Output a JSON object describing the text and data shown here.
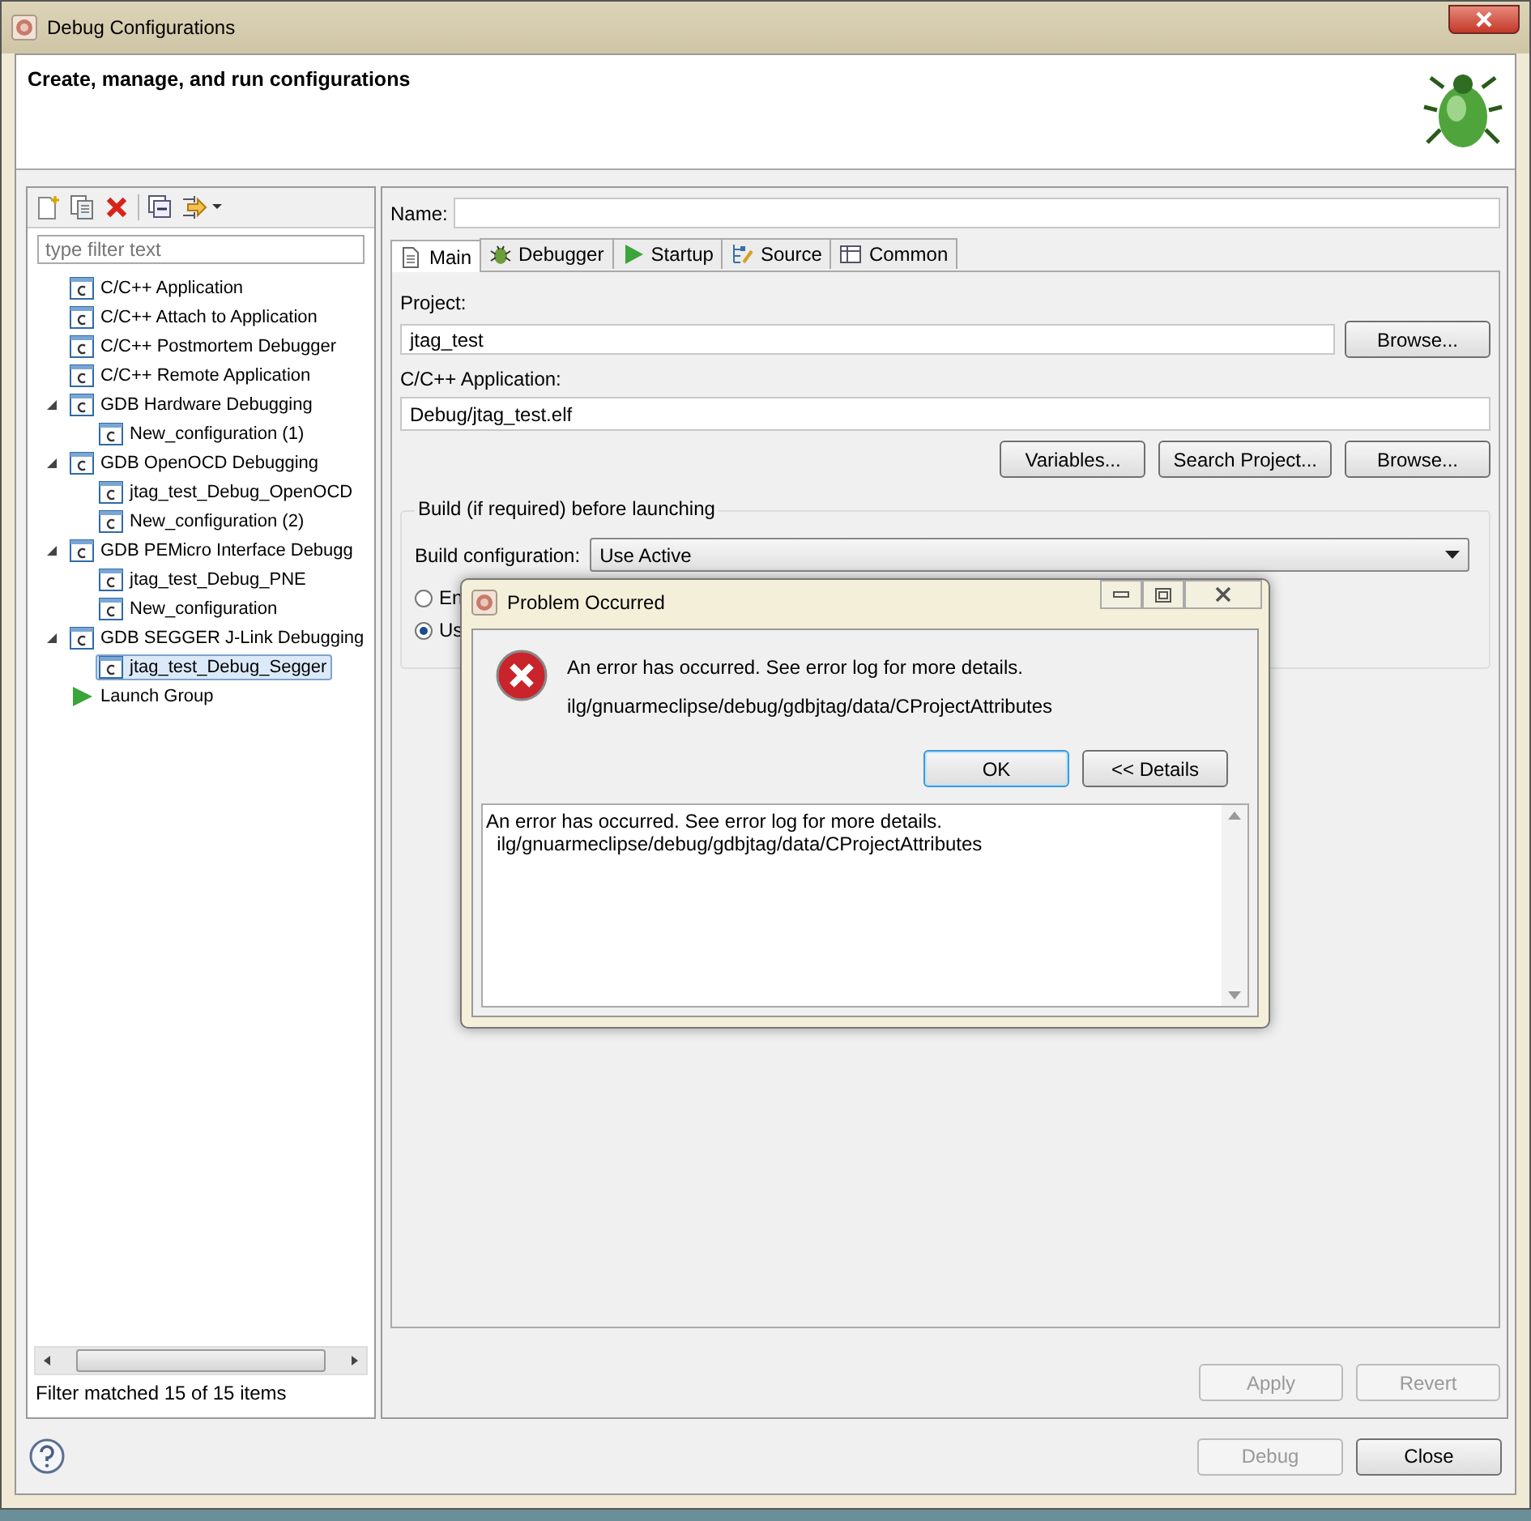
{
  "window": {
    "title": "Debug Configurations"
  },
  "header": {
    "title": "Create, manage, and run configurations"
  },
  "filter": {
    "placeholder": "type filter text"
  },
  "tree": [
    {
      "label": "C/C++ Application",
      "kind": "config",
      "selected": false
    },
    {
      "label": "C/C++ Attach to Application",
      "kind": "config",
      "selected": false
    },
    {
      "label": "C/C++ Postmortem Debugger",
      "kind": "config",
      "selected": false
    },
    {
      "label": "C/C++ Remote Application",
      "kind": "config",
      "selected": false
    },
    {
      "label": "GDB Hardware Debugging",
      "kind": "config",
      "selected": false,
      "expanded": true,
      "children": [
        {
          "label": "New_configuration (1)",
          "kind": "config",
          "selected": false
        }
      ]
    },
    {
      "label": "GDB OpenOCD Debugging",
      "kind": "config",
      "selected": false,
      "expanded": true,
      "children": [
        {
          "label": "jtag_test_Debug_OpenOCD",
          "kind": "config",
          "selected": false
        },
        {
          "label": "New_configuration (2)",
          "kind": "config",
          "selected": false
        }
      ]
    },
    {
      "label": "GDB PEMicro Interface Debugg",
      "kind": "config",
      "selected": false,
      "expanded": true,
      "children": [
        {
          "label": "jtag_test_Debug_PNE",
          "kind": "config",
          "selected": false
        },
        {
          "label": "New_configuration",
          "kind": "config",
          "selected": false
        }
      ]
    },
    {
      "label": "GDB SEGGER J-Link Debugging",
      "kind": "config",
      "selected": false,
      "expanded": true,
      "children": [
        {
          "label": "jtag_test_Debug_Segger",
          "kind": "config",
          "selected": true
        }
      ]
    },
    {
      "label": "Launch Group",
      "kind": "launch",
      "selected": false
    }
  ],
  "filter_status": "Filter matched 15 of 15 items",
  "name": {
    "label": "Name:"
  },
  "tabs": [
    {
      "label": "Main",
      "selected": true
    },
    {
      "label": "Debugger",
      "selected": false
    },
    {
      "label": "Startup",
      "selected": false
    },
    {
      "label": "Source",
      "selected": false
    },
    {
      "label": "Common",
      "selected": false
    }
  ],
  "project": {
    "label": "Project:",
    "value": "jtag_test",
    "button": "Browse..."
  },
  "application": {
    "label": "C/C++ Application:",
    "value": "Debug/jtag_test.elf",
    "buttons": [
      "Variables...",
      "Search Project...",
      "Browse..."
    ]
  },
  "build": {
    "title": "Build (if required) before launching",
    "config_label": "Build configuration:",
    "config_value": "Use Active",
    "radios": [
      {
        "label": "En",
        "selected": false
      },
      {
        "label": "Us",
        "selected": true
      }
    ]
  },
  "form_buttons": [
    {
      "label": "Apply",
      "disabled": true
    },
    {
      "label": "Revert",
      "disabled": true
    }
  ],
  "footer_buttons": [
    {
      "label": "Debug",
      "disabled": true
    },
    {
      "label": "Close",
      "disabled": false
    }
  ],
  "dialog": {
    "title": "Problem Occurred",
    "message": "An error has occurred. See error log for more details.",
    "detail": "ilg/gnuarmeclipse/debug/gdbjtag/data/CProjectAttributes",
    "buttons": [
      {
        "label": "OK",
        "default": true
      },
      {
        "label": "<< Details",
        "default": false
      }
    ],
    "details_lines": [
      "An error has occurred. See error log for more details.",
      "  ilg/gnuarmeclipse/debug/gdbjtag/data/CProjectAttributes"
    ]
  }
}
